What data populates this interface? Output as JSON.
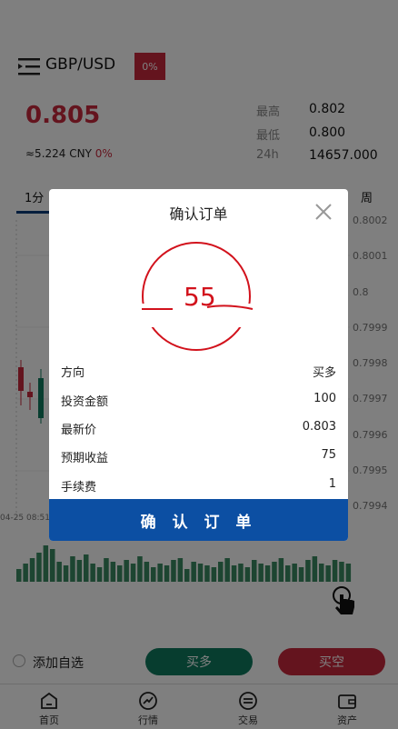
{
  "header": {
    "pair": "GBP/USD",
    "change_badge": "0%"
  },
  "quote": {
    "price": "0.805",
    "cny": "≈5.224 CNY",
    "cny_change": "0%",
    "high_label": "最高",
    "high_value": "0.802",
    "low_label": "最低",
    "low_value": "0.800",
    "vol_label": "24h",
    "vol_value": "14657.000"
  },
  "tabs": {
    "first": "1分",
    "last": "周"
  },
  "chart": {
    "y_ticks": [
      "0.8002",
      "0.8001",
      "0.8",
      "0.7999",
      "0.7998",
      "0.7997",
      "0.7996",
      "0.7995",
      "0.7994"
    ],
    "date_label": "04-25 08:51"
  },
  "actions": {
    "favorite_label": "添加自选",
    "buy_label": "买多",
    "sell_label": "买空"
  },
  "nav": {
    "items": [
      {
        "label": "首页",
        "icon": "home-icon"
      },
      {
        "label": "行情",
        "icon": "market-icon"
      },
      {
        "label": "交易",
        "icon": "trade-icon"
      },
      {
        "label": "资产",
        "icon": "wallet-icon"
      }
    ]
  },
  "modal": {
    "title": "确认订单",
    "stamp_text": "55",
    "rows": [
      {
        "label": "方向",
        "value": "买多"
      },
      {
        "label": "投资金额",
        "value": "100"
      },
      {
        "label": "最新价",
        "value": "0.803"
      },
      {
        "label": "预期收益",
        "value": "75"
      },
      {
        "label": "手续费",
        "value": "1"
      }
    ],
    "confirm_label": "确 认 订 单"
  },
  "colors": {
    "up": "#0e7a5f",
    "down": "#c9283c",
    "primary": "#0c4fa3"
  }
}
